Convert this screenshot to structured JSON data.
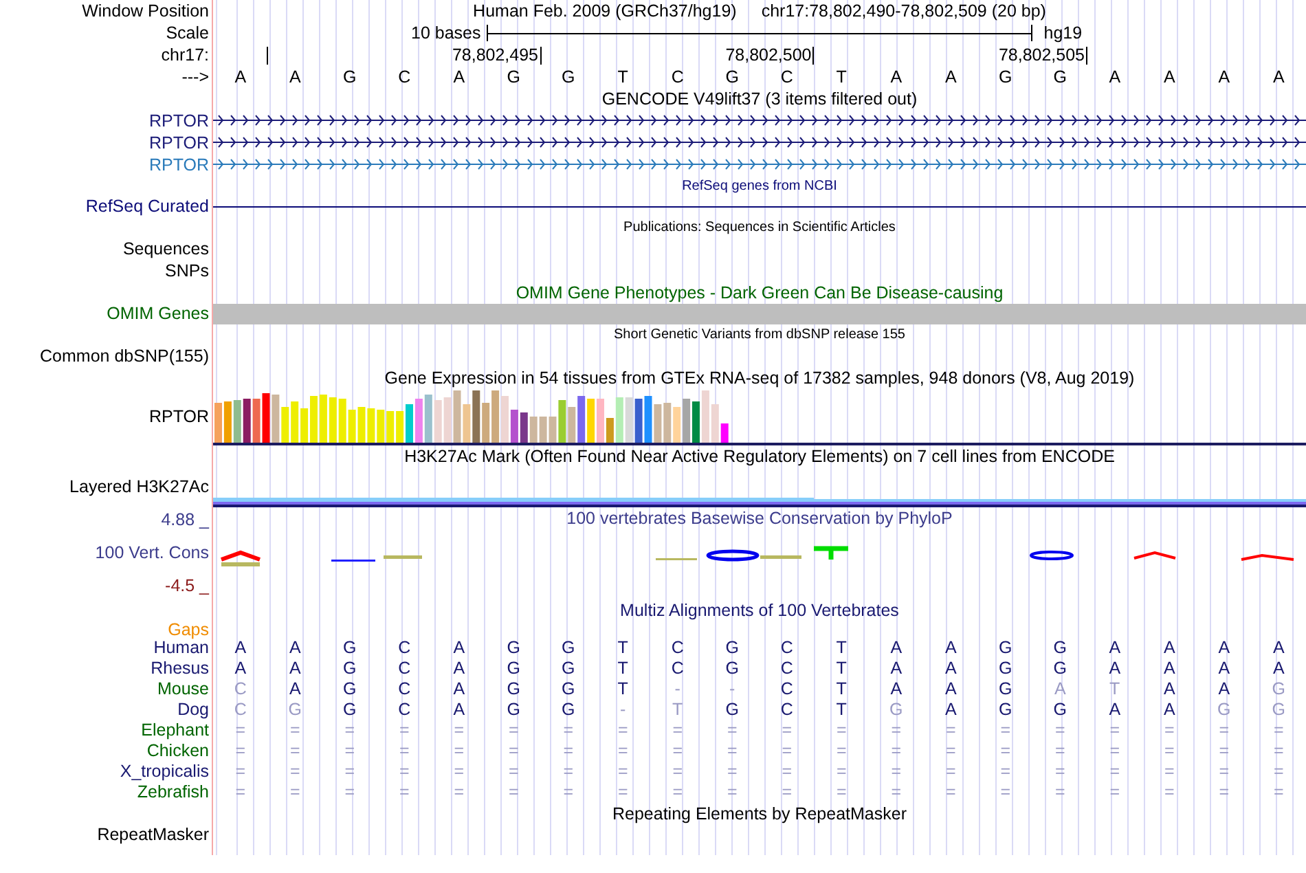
{
  "window_position": {
    "label": "Window Position",
    "assembly": "Human Feb. 2009 (GRCh37/hg19)",
    "position": "chr17:78,802,490-78,802,509 (20 bp)"
  },
  "scale": {
    "label": "Scale",
    "span": "10 bases",
    "assembly": "hg19"
  },
  "coordinates": {
    "label": "chr17:",
    "ticks": [
      "78,802,495",
      "78,802,500",
      "78,802,505"
    ]
  },
  "sequence": {
    "label": "--->",
    "bases": [
      "A",
      "A",
      "G",
      "C",
      "A",
      "G",
      "G",
      "T",
      "C",
      "G",
      "C",
      "T",
      "A",
      "A",
      "G",
      "G",
      "A",
      "A",
      "A",
      "A"
    ]
  },
  "tracks": [
    {
      "kind": "genes",
      "title": "GENCODE V49lift37 (3 items filtered out)",
      "items": [
        {
          "name": "RPTOR",
          "color": "#1c1c78"
        },
        {
          "name": "RPTOR",
          "color": "#1c1c78"
        },
        {
          "name": "RPTOR",
          "color": "#2b7bba"
        }
      ]
    },
    {
      "kind": "line",
      "title": "RefSeq genes from NCBI",
      "label": "RefSeq Curated",
      "color": "#0c0c78"
    },
    {
      "kind": "labels",
      "title": "Publications: Sequences in Scientific Articles",
      "labels": [
        "Sequences",
        "SNPs"
      ]
    },
    {
      "kind": "bar",
      "title": "OMIM Gene Phenotypes - Dark Green Can Be Disease-causing",
      "label": "OMIM Genes",
      "color": "#006400"
    },
    {
      "kind": "labels",
      "title": "Short Genetic Variants from dbSNP release 155",
      "labels": [
        "Common dbSNP(155)"
      ]
    },
    {
      "kind": "expression",
      "title": "Gene Expression in 54 tissues from GTEx RNA-seq of 17382 samples, 948 donors (V8, Aug 2019)",
      "label": "RPTOR"
    },
    {
      "kind": "signal",
      "title": "H3K27Ac Mark (Often Found Near Active Regulatory Elements) on 7 cell lines from ENCODE",
      "label": "Layered H3K27Ac"
    },
    {
      "kind": "conservation",
      "title": "100 vertebrates Basewise Conservation by PhyloP",
      "label": "100 Vert. Cons",
      "max": "4.88 _",
      "min": "-4.5 _",
      "color": "#3c3c8c"
    },
    {
      "kind": "alignment",
      "title": "Multiz Alignments of 100 Vertebrates",
      "gaps_label": "Gaps",
      "color": "#191970",
      "species": [
        {
          "name": "Human",
          "color": "#191970",
          "bases": [
            {
              "base": "A",
              "faded": false
            },
            {
              "base": "A",
              "faded": false
            },
            {
              "base": "G",
              "faded": false
            },
            {
              "base": "C",
              "faded": false
            },
            {
              "base": "A",
              "faded": false
            },
            {
              "base": "G",
              "faded": false
            },
            {
              "base": "G",
              "faded": false
            },
            {
              "base": "T",
              "faded": false
            },
            {
              "base": "C",
              "faded": false
            },
            {
              "base": "G",
              "faded": false
            },
            {
              "base": "C",
              "faded": false
            },
            {
              "base": "T",
              "faded": false
            },
            {
              "base": "A",
              "faded": false
            },
            {
              "base": "A",
              "faded": false
            },
            {
              "base": "G",
              "faded": false
            },
            {
              "base": "G",
              "faded": false
            },
            {
              "base": "A",
              "faded": false
            },
            {
              "base": "A",
              "faded": false
            },
            {
              "base": "A",
              "faded": false
            },
            {
              "base": "A",
              "faded": false
            }
          ]
        },
        {
          "name": "Rhesus",
          "color": "#191970",
          "bases": [
            {
              "base": "A",
              "faded": false
            },
            {
              "base": "A",
              "faded": false
            },
            {
              "base": "G",
              "faded": false
            },
            {
              "base": "C",
              "faded": false
            },
            {
              "base": "A",
              "faded": false
            },
            {
              "base": "G",
              "faded": false
            },
            {
              "base": "G",
              "faded": false
            },
            {
              "base": "T",
              "faded": false
            },
            {
              "base": "C",
              "faded": false
            },
            {
              "base": "G",
              "faded": false
            },
            {
              "base": "C",
              "faded": false
            },
            {
              "base": "T",
              "faded": false
            },
            {
              "base": "A",
              "faded": false
            },
            {
              "base": "A",
              "faded": false
            },
            {
              "base": "G",
              "faded": false
            },
            {
              "base": "G",
              "faded": false
            },
            {
              "base": "A",
              "faded": false
            },
            {
              "base": "A",
              "faded": false
            },
            {
              "base": "A",
              "faded": false
            },
            {
              "base": "A",
              "faded": false
            }
          ]
        },
        {
          "name": "Mouse",
          "color": "#006400",
          "bases": [
            {
              "base": "C",
              "faded": true
            },
            {
              "base": "A",
              "faded": false
            },
            {
              "base": "G",
              "faded": false
            },
            {
              "base": "C",
              "faded": false
            },
            {
              "base": "A",
              "faded": false
            },
            {
              "base": "G",
              "faded": false
            },
            {
              "base": "G",
              "faded": false
            },
            {
              "base": "T",
              "faded": false
            },
            {
              "base": "-",
              "faded": true
            },
            {
              "base": "-",
              "faded": true
            },
            {
              "base": "C",
              "faded": false
            },
            {
              "base": "T",
              "faded": false
            },
            {
              "base": "A",
              "faded": false
            },
            {
              "base": "A",
              "faded": false
            },
            {
              "base": "G",
              "faded": false
            },
            {
              "base": "A",
              "faded": true
            },
            {
              "base": "T",
              "faded": true
            },
            {
              "base": "A",
              "faded": false
            },
            {
              "base": "A",
              "faded": false
            },
            {
              "base": "G",
              "faded": true
            }
          ]
        },
        {
          "name": "Dog",
          "color": "#191970",
          "bases": [
            {
              "base": "C",
              "faded": true
            },
            {
              "base": "G",
              "faded": true
            },
            {
              "base": "G",
              "faded": false
            },
            {
              "base": "C",
              "faded": false
            },
            {
              "base": "A",
              "faded": false
            },
            {
              "base": "G",
              "faded": false
            },
            {
              "base": "G",
              "faded": false
            },
            {
              "base": "-",
              "faded": true
            },
            {
              "base": "T",
              "faded": true
            },
            {
              "base": "G",
              "faded": false
            },
            {
              "base": "C",
              "faded": false
            },
            {
              "base": "T",
              "faded": false
            },
            {
              "base": "G",
              "faded": true
            },
            {
              "base": "A",
              "faded": false
            },
            {
              "base": "G",
              "faded": false
            },
            {
              "base": "G",
              "faded": false
            },
            {
              "base": "A",
              "faded": false
            },
            {
              "base": "A",
              "faded": false
            },
            {
              "base": "G",
              "faded": true
            },
            {
              "base": "G",
              "faded": true
            }
          ]
        },
        {
          "name": "Elephant",
          "color": "#006400",
          "bases": [
            {
              "base": "=",
              "faded": true
            },
            {
              "base": "=",
              "faded": true
            },
            {
              "base": "=",
              "faded": true
            },
            {
              "base": "=",
              "faded": true
            },
            {
              "base": "=",
              "faded": true
            },
            {
              "base": "=",
              "faded": true
            },
            {
              "base": "=",
              "faded": true
            },
            {
              "base": "=",
              "faded": true
            },
            {
              "base": "=",
              "faded": true
            },
            {
              "base": "=",
              "faded": true
            },
            {
              "base": "=",
              "faded": true
            },
            {
              "base": "=",
              "faded": true
            },
            {
              "base": "=",
              "faded": true
            },
            {
              "base": "=",
              "faded": true
            },
            {
              "base": "=",
              "faded": true
            },
            {
              "base": "=",
              "faded": true
            },
            {
              "base": "=",
              "faded": true
            },
            {
              "base": "=",
              "faded": true
            },
            {
              "base": "=",
              "faded": true
            },
            {
              "base": "=",
              "faded": true
            }
          ]
        },
        {
          "name": "Chicken",
          "color": "#006400",
          "bases": [
            {
              "base": "=",
              "faded": true
            },
            {
              "base": "=",
              "faded": true
            },
            {
              "base": "=",
              "faded": true
            },
            {
              "base": "=",
              "faded": true
            },
            {
              "base": "=",
              "faded": true
            },
            {
              "base": "=",
              "faded": true
            },
            {
              "base": "=",
              "faded": true
            },
            {
              "base": "=",
              "faded": true
            },
            {
              "base": "=",
              "faded": true
            },
            {
              "base": "=",
              "faded": true
            },
            {
              "base": "=",
              "faded": true
            },
            {
              "base": "=",
              "faded": true
            },
            {
              "base": "=",
              "faded": true
            },
            {
              "base": "=",
              "faded": true
            },
            {
              "base": "=",
              "faded": true
            },
            {
              "base": "=",
              "faded": true
            },
            {
              "base": "=",
              "faded": true
            },
            {
              "base": "=",
              "faded": true
            },
            {
              "base": "=",
              "faded": true
            },
            {
              "base": "=",
              "faded": true
            }
          ]
        },
        {
          "name": "X_tropicalis",
          "color": "#191970",
          "bases": [
            {
              "base": "=",
              "faded": true
            },
            {
              "base": "=",
              "faded": true
            },
            {
              "base": "=",
              "faded": true
            },
            {
              "base": "=",
              "faded": true
            },
            {
              "base": "=",
              "faded": true
            },
            {
              "base": "=",
              "faded": true
            },
            {
              "base": "=",
              "faded": true
            },
            {
              "base": "=",
              "faded": true
            },
            {
              "base": "=",
              "faded": true
            },
            {
              "base": "=",
              "faded": true
            },
            {
              "base": "=",
              "faded": true
            },
            {
              "base": "=",
              "faded": true
            },
            {
              "base": "=",
              "faded": true
            },
            {
              "base": "=",
              "faded": true
            },
            {
              "base": "=",
              "faded": true
            },
            {
              "base": "=",
              "faded": true
            },
            {
              "base": "=",
              "faded": true
            },
            {
              "base": "=",
              "faded": true
            },
            {
              "base": "=",
              "faded": true
            },
            {
              "base": "=",
              "faded": true
            }
          ]
        },
        {
          "name": "Zebrafish",
          "color": "#006400",
          "bases": [
            {
              "base": "=",
              "faded": true
            },
            {
              "base": "=",
              "faded": true
            },
            {
              "base": "=",
              "faded": true
            },
            {
              "base": "=",
              "faded": true
            },
            {
              "base": "=",
              "faded": true
            },
            {
              "base": "=",
              "faded": true
            },
            {
              "base": "=",
              "faded": true
            },
            {
              "base": "=",
              "faded": true
            },
            {
              "base": "=",
              "faded": true
            },
            {
              "base": "=",
              "faded": true
            },
            {
              "base": "=",
              "faded": true
            },
            {
              "base": "=",
              "faded": true
            },
            {
              "base": "=",
              "faded": true
            },
            {
              "base": "=",
              "faded": true
            },
            {
              "base": "=",
              "faded": true
            },
            {
              "base": "=",
              "faded": true
            },
            {
              "base": "=",
              "faded": true
            },
            {
              "base": "=",
              "faded": true
            },
            {
              "base": "=",
              "faded": true
            },
            {
              "base": "=",
              "faded": true
            }
          ]
        }
      ]
    },
    {
      "kind": "empty",
      "title": "Repeating Elements by RepeatMasker",
      "label": "RepeatMasker"
    }
  ]
}
